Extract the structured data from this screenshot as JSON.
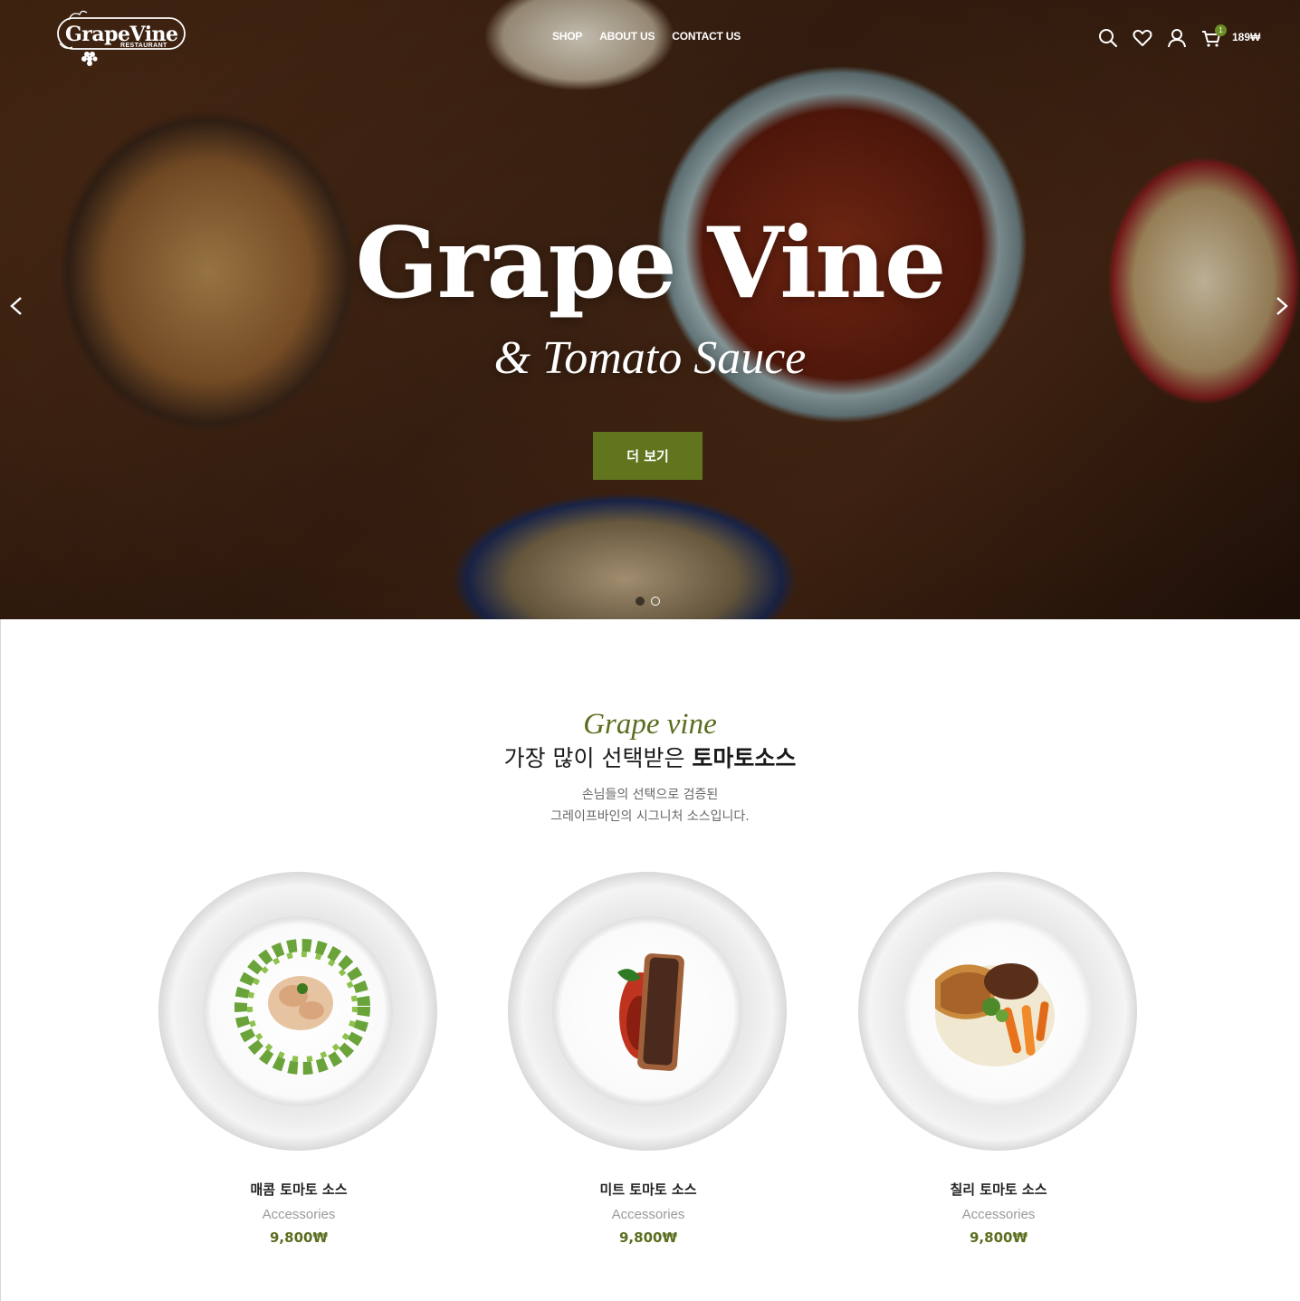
{
  "header": {
    "logo_text": "GrapeVine",
    "logo_sub": "RESTAURANT",
    "nav": [
      "SHOP",
      "ABOUT US",
      "CONTACT US"
    ],
    "icons": [
      "search-icon",
      "heart-icon",
      "user-icon",
      "cart-icon"
    ],
    "cart_count": "1",
    "cart_total": "189₩"
  },
  "hero": {
    "title": "Grape Vine",
    "subtitle": "& Tomato Sauce",
    "button_label": "더 보기",
    "slide_count": 2,
    "active_slide": 1
  },
  "section": {
    "script_title": "Grape vine",
    "title_plain": "가장 많이 선택받은 ",
    "title_bold": "토마토소스",
    "desc_line1": "손님들의 선택으로 검증된",
    "desc_line2": "그레이프바인의 시그니처 소스입니다."
  },
  "products": [
    {
      "name": "매콤 토마토 소스",
      "category": "Accessories",
      "price": "9,800₩"
    },
    {
      "name": "미트 토마토 소스",
      "category": "Accessories",
      "price": "9,800₩"
    },
    {
      "name": "칠리 토마토 소스",
      "category": "Accessories",
      "price": "9,800₩"
    }
  ],
  "colors": {
    "accent": "#61751f",
    "accent_text": "#5a6e1f",
    "badge": "#6b8e23"
  }
}
